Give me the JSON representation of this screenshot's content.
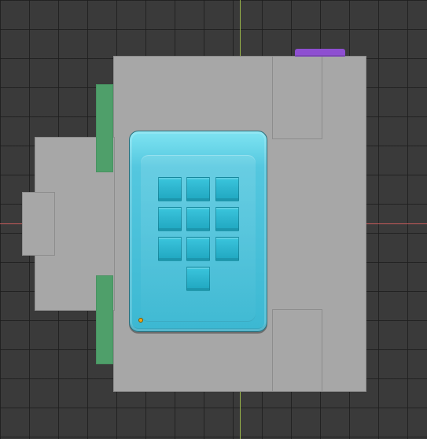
{
  "scene": {
    "type": "3d viewport",
    "colors": {
      "background": "#3a3a3a",
      "grid_lines": "#1e1e1e",
      "axis_x": "#c75b5b",
      "axis_y": "#99b54a",
      "body_gray": "#a7a7a7",
      "green": "#4f9f6a",
      "purple": "#8e4fd1",
      "keypad": "#54c7df",
      "key": "#2fb6cf",
      "dot": "#f3a313"
    },
    "icons": {
      "origin_marker": "small-orange-dot"
    }
  }
}
